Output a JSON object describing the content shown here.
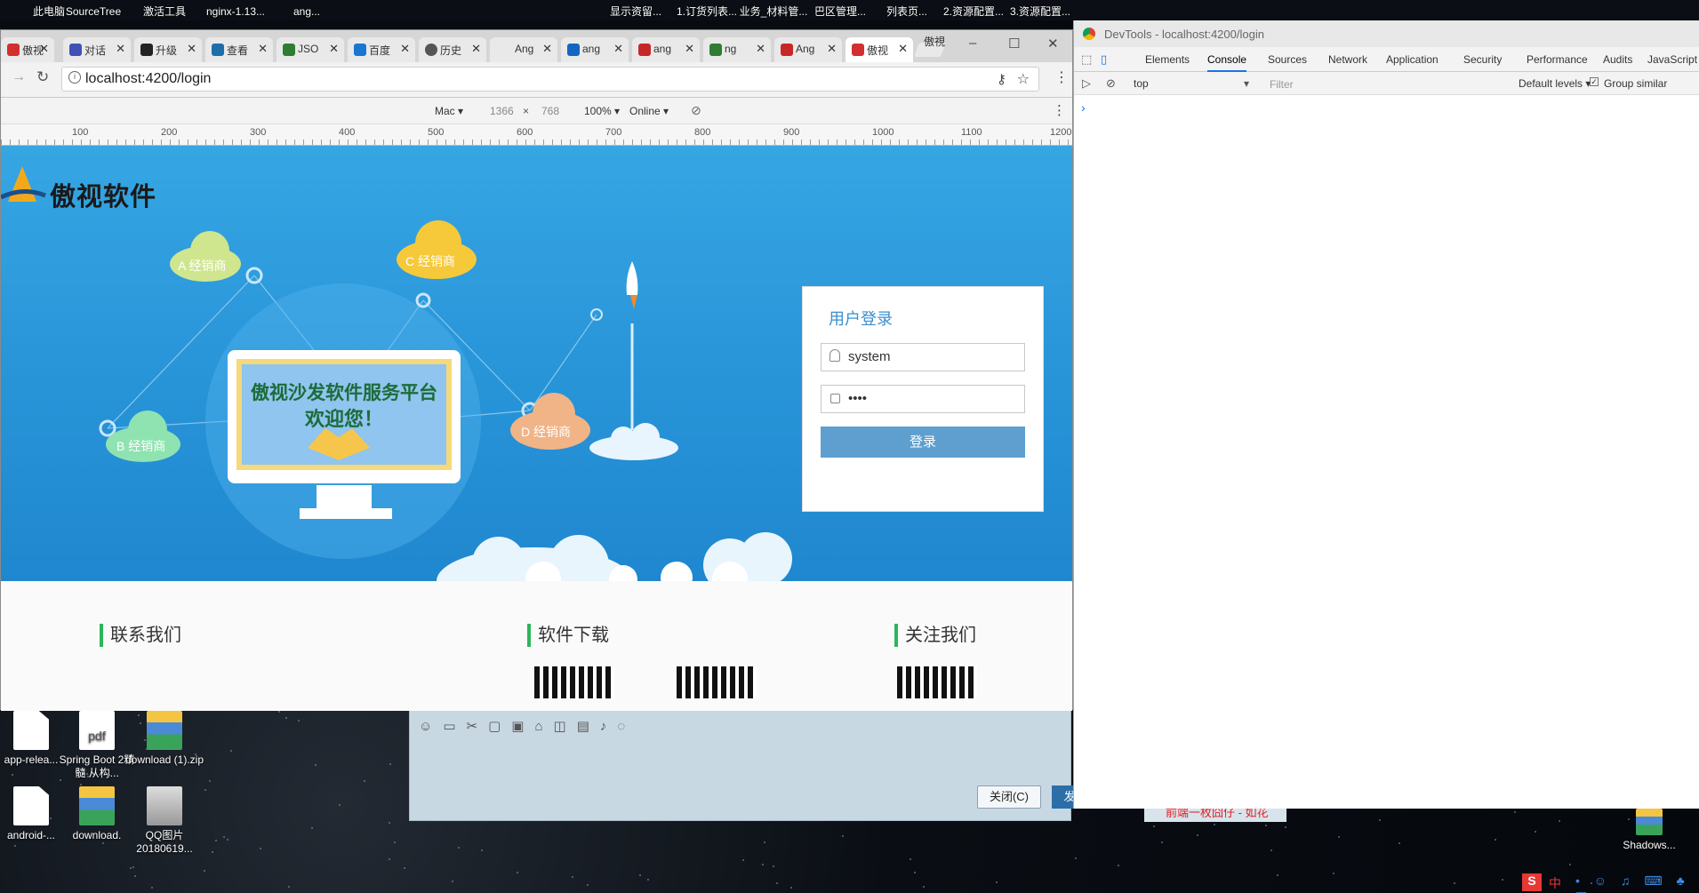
{
  "desktop": {
    "icons_top": [
      "此电脑",
      "SourceTree",
      "激活工具",
      "nginx-1.13...",
      "ang..."
    ],
    "icons_top_right": [
      "显示资留...",
      "1.订货列表...",
      "业务_材料管...",
      "巴区管理...",
      "列表页...",
      "2.资源配置...",
      "3.资源配置..."
    ],
    "icons_left": [
      {
        "label": "app-relea...",
        "type": "file"
      },
      {
        "label": "Spring Boot 2精髓 从构...",
        "type": "pdf"
      },
      {
        "label": "download (1).zip",
        "type": "zip"
      },
      {
        "label": "android-...",
        "type": "file"
      },
      {
        "label": "download.",
        "type": "zip"
      },
      {
        "label": "QQ图片 20180619...",
        "type": "photo"
      }
    ],
    "icon_right": "Shadows...",
    "taskbar_note": "前端一枚囧仔 - 如花",
    "ime": "中"
  },
  "browser": {
    "window_title_user": "傲視",
    "tabs": [
      {
        "label": "傲视",
        "color": "#d32f2f",
        "active": false
      },
      {
        "label": "对话",
        "color": "#3f51b5",
        "active": false
      },
      {
        "label": "升级",
        "color": "#222222",
        "active": false
      },
      {
        "label": "查看",
        "color": "#1e6fa8",
        "active": false
      },
      {
        "label": "JSO",
        "color": "#2e7d32",
        "active": false
      },
      {
        "label": "百度",
        "color": "#1976d2",
        "active": false
      },
      {
        "label": "历史",
        "color": "#555555",
        "active": false
      },
      {
        "label": "Ang",
        "color": "#777777",
        "active": false
      },
      {
        "label": "ang",
        "color": "#1565c0",
        "active": false
      },
      {
        "label": "ang",
        "color": "#c62828",
        "active": false
      },
      {
        "label": "ng",
        "color": "#2e7d32",
        "active": false
      },
      {
        "label": "Ang",
        "color": "#c62828",
        "active": false
      },
      {
        "label": "傲视",
        "color": "#d32f2f",
        "active": true
      }
    ],
    "url": "localhost:4200/login",
    "device_toolbar": {
      "device": "Mac ▾",
      "width": "1366",
      "times": "×",
      "height": "768",
      "zoom": "100% ▾",
      "network": "Online ▾"
    },
    "ruler_labels": [
      "100",
      "200",
      "300",
      "400",
      "500",
      "600",
      "700",
      "800",
      "900",
      "1000",
      "1100",
      "1200"
    ]
  },
  "page": {
    "brand": "傲视软件",
    "monitor_line1": "傲视沙发软件服务平台",
    "monitor_line2": "欢迎您！",
    "clouds": {
      "a": "A 经销商",
      "b": "B 经销商",
      "c": "C 经销商",
      "d": "D 经销商"
    },
    "login": {
      "title": "用户登录",
      "username": "system",
      "password_mask": "••••",
      "submit": "登录"
    },
    "footer": {
      "contact": "联系我们",
      "download": "软件下载",
      "follow": "关注我们"
    }
  },
  "qqchat": {
    "close_button": "关闭(C)",
    "send_button": "发"
  },
  "devtools": {
    "title": "DevTools - localhost:4200/login",
    "tabs": [
      "Elements",
      "Console",
      "Sources",
      "Network",
      "Application",
      "Security",
      "Performance",
      "Audits",
      "JavaScript"
    ],
    "active_tab": "Console",
    "context": "top",
    "filter_placeholder": "Filter",
    "levels": "Default levels ▾",
    "group_similar": "Group similar",
    "prompt": "›"
  },
  "colors": {
    "hero_blue": "#2a97da",
    "accent_green": "#2db55d",
    "login_button": "#5e9fcf",
    "login_title": "#3a8fd0"
  }
}
